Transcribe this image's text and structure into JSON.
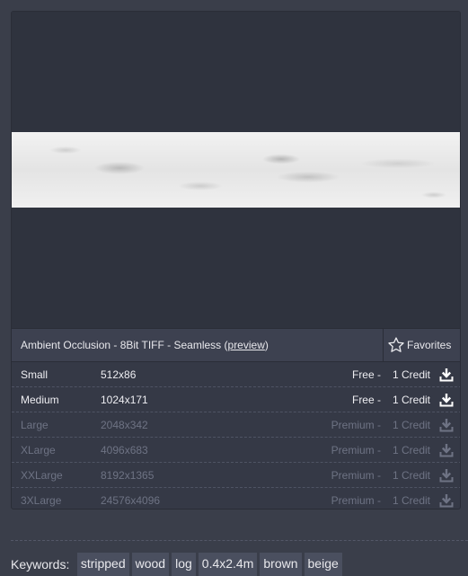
{
  "map": {
    "title_prefix": "Ambient Occlusion - 8Bit TIFF - Seamless (",
    "preview_link": "preview",
    "title_suffix": ")"
  },
  "favorites": {
    "label": "Favorites",
    "icon": "star-outline-icon"
  },
  "downloads": [
    {
      "name": "Small",
      "resolution": "512x86",
      "tier": "Free -",
      "credit": "1 Credit",
      "available": true
    },
    {
      "name": "Medium",
      "resolution": "1024x171",
      "tier": "Free -",
      "credit": "1 Credit",
      "available": true
    },
    {
      "name": "Large",
      "resolution": "2048x342",
      "tier": "Premium -",
      "credit": "1 Credit",
      "available": false
    },
    {
      "name": "XLarge",
      "resolution": "4096x683",
      "tier": "Premium -",
      "credit": "1 Credit",
      "available": false
    },
    {
      "name": "XXLarge",
      "resolution": "8192x1365",
      "tier": "Premium -",
      "credit": "1 Credit",
      "available": false
    },
    {
      "name": "3XLarge",
      "resolution": "24576x4096",
      "tier": "Premium -",
      "credit": "1 Credit",
      "available": false
    }
  ],
  "keywords": {
    "label": "Keywords:",
    "tags": [
      "stripped",
      "wood",
      "log",
      "0.4x2.4m",
      "brown",
      "beige"
    ]
  },
  "colors": {
    "background": "#3a3e4a",
    "card": "#353946",
    "free_text": "#eeeef2",
    "premium_text": "#6e7384",
    "tag_bg": "#4a4f5f"
  }
}
